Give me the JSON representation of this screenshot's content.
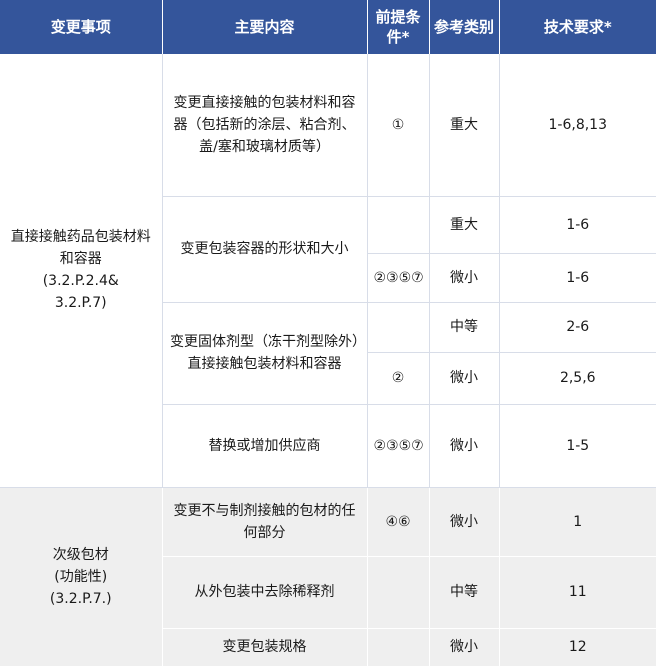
{
  "headers": {
    "h1": "变更事项",
    "h2": "主要内容",
    "h3": "前提条件*",
    "h4": "参考类别",
    "h5": "技术要求*"
  },
  "group1": {
    "label": "直接接触药品包装材料和容器\n(3.2.P.2.4&\n3.2.P.7)",
    "r1": {
      "content": "变更直接接触的包装材料和容器（包括新的涂层、粘合剂、盖/塞和玻璃材质等）",
      "cond": "①",
      "cat": "重大",
      "req": "1-6,8,13"
    },
    "r2": {
      "content": "变更包装容器的形状和大小",
      "cond": "",
      "cat": "重大",
      "req": "1-6"
    },
    "r3": {
      "cond": "②③⑤⑦",
      "cat": "微小",
      "req": "1-6"
    },
    "r4": {
      "content": "变更固体剂型（冻干剂型除外）直接接触包装材料和容器",
      "cond": "",
      "cat": "中等",
      "req": "2-6"
    },
    "r5": {
      "cond": "②",
      "cat": "微小",
      "req": "2,5,6"
    },
    "r6": {
      "content": "替换或增加供应商",
      "cond": "②③⑤⑦",
      "cat": "微小",
      "req": "1-5"
    }
  },
  "group2": {
    "label": "次级包材\n(功能性)\n(3.2.P.7.)",
    "r1": {
      "content": "变更不与制剂接触的包材的任何部分",
      "cond": "④⑥",
      "cat": "微小",
      "req": "1"
    },
    "r2": {
      "content": "从外包装中去除稀释剂",
      "cond": "",
      "cat": "中等",
      "req": "11"
    },
    "r3": {
      "content": "变更包装规格",
      "cond": "",
      "cat": "微小",
      "req": "12"
    }
  }
}
